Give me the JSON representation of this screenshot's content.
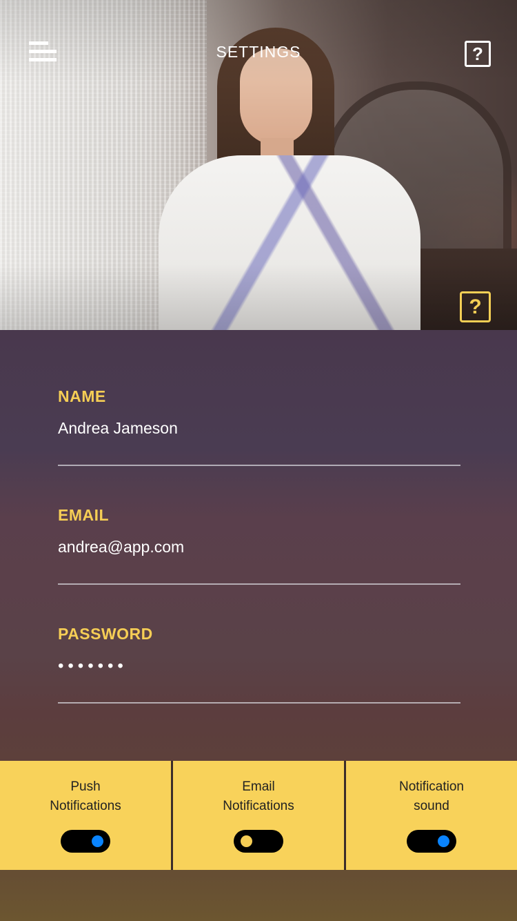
{
  "header": {
    "title": "SETTINGS",
    "menu_icon": "menu-icon",
    "help_icon": "help-icon",
    "help_glyph": "?"
  },
  "hero": {
    "photo": "portrait-photo",
    "help_glyph": "?"
  },
  "form": {
    "name": {
      "label": "NAME",
      "value": "Andrea Jameson"
    },
    "email": {
      "label": "EMAIL",
      "value": "andrea@app.com"
    },
    "password": {
      "label": "PASSWORD",
      "value": "•••••••"
    }
  },
  "toggles": [
    {
      "label": "Push\nNotifications",
      "on": true
    },
    {
      "label": "Email\nNotifications",
      "on": false
    },
    {
      "label": "Notification\nsound",
      "on": true
    }
  ],
  "colors": {
    "accent": "#f6ce55",
    "toggle_on": "#0a84ff",
    "toggle_track": "#000000"
  }
}
